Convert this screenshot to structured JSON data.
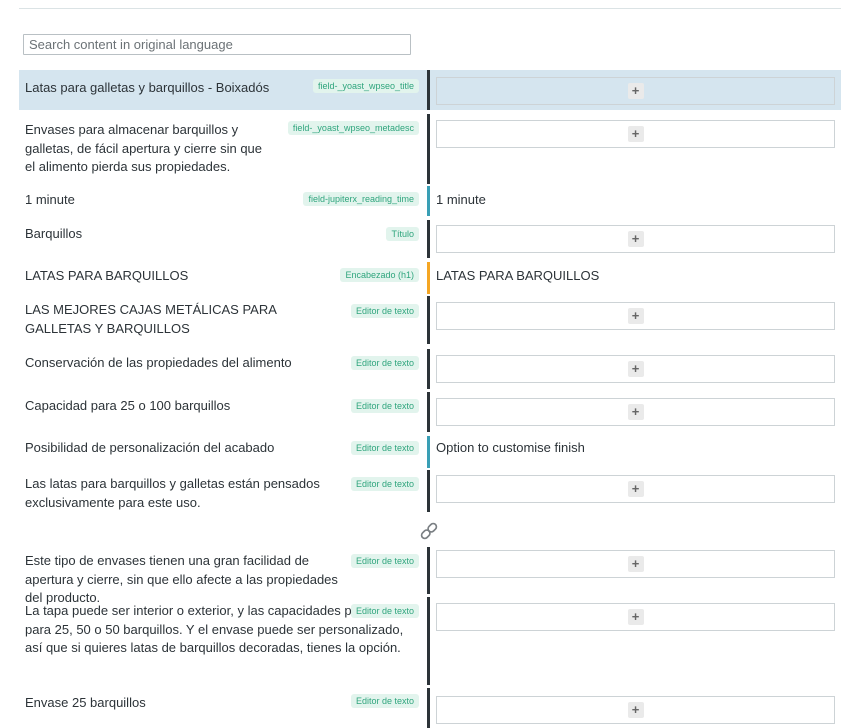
{
  "search": {
    "placeholder": "Search content in original language",
    "value": ""
  },
  "rows": [
    {
      "source": "Latas para galletas y barquillos - Boixadós",
      "tag": "field-_yoast_wpseo_title",
      "target": "",
      "status": "untranslated"
    },
    {
      "source": "Envases para almacenar barquillos y galletas, de fácil apertura y cierre sin que el alimento pierda sus propiedades.",
      "tag": "field-_yoast_wpseo_metadesc",
      "target": "",
      "status": "untranslated"
    },
    {
      "source": "1 minute",
      "tag": "field-jupiterx_reading_time",
      "target": "1 minute",
      "status": "translated"
    },
    {
      "source": "Barquillos",
      "tag": "Título",
      "target": "",
      "status": "untranslated"
    },
    {
      "source": "LATAS PARA BARQUILLOS",
      "tag": "Encabezado (h1)",
      "target": "LATAS PARA BARQUILLOS",
      "status": "needs-update"
    },
    {
      "source": "LAS MEJORES CAJAS METÁLICAS PARA GALLETAS Y BARQUILLOS",
      "tag": "Editor de texto",
      "target": "",
      "status": "untranslated"
    },
    {
      "source": "Conservación de las propiedades del alimento",
      "tag": "Editor de texto",
      "target": "",
      "status": "untranslated"
    },
    {
      "source": "Capacidad para 25 o 100 barquillos",
      "tag": "Editor de texto",
      "target": "",
      "status": "untranslated"
    },
    {
      "source": "Posibilidad de personalización del acabado",
      "tag": "Editor de texto",
      "target": "Option to customise finish",
      "status": "translated"
    },
    {
      "source": "Las latas para barquillos y galletas están pensados exclusivamente para este uso.",
      "tag": "Editor de texto",
      "target": "",
      "status": "untranslated"
    },
    {
      "source": "Este tipo de envases tienen una gran facilidad de apertura y cierre, sin que ello afecte a las propiedades del producto.",
      "tag": "Editor de texto",
      "target": "",
      "status": "untranslated"
    },
    {
      "source": "La tapa puede ser interior o exterior, y las capacidades pueden ser para 25, 50 o 50 barquillos. Y el envase puede ser personalizado, así que si quieres latas de barquillos decoradas, tienes la opción.",
      "tag": "Editor de texto",
      "target": "",
      "status": "untranslated"
    },
    {
      "source": "Envase 25 barquillos",
      "tag": "Editor de texto",
      "target": "",
      "status": "untranslated"
    }
  ],
  "colors": {
    "tag_bg": "#e2f4ed",
    "tag_text": "#2fa57d",
    "untranslated": "#2c3338",
    "translated": "#3a9fb5",
    "needs_update": "#f5a623",
    "highlight": "#d5e5ef"
  },
  "icons": {
    "add": "plus-icon",
    "link": "link-icon"
  }
}
